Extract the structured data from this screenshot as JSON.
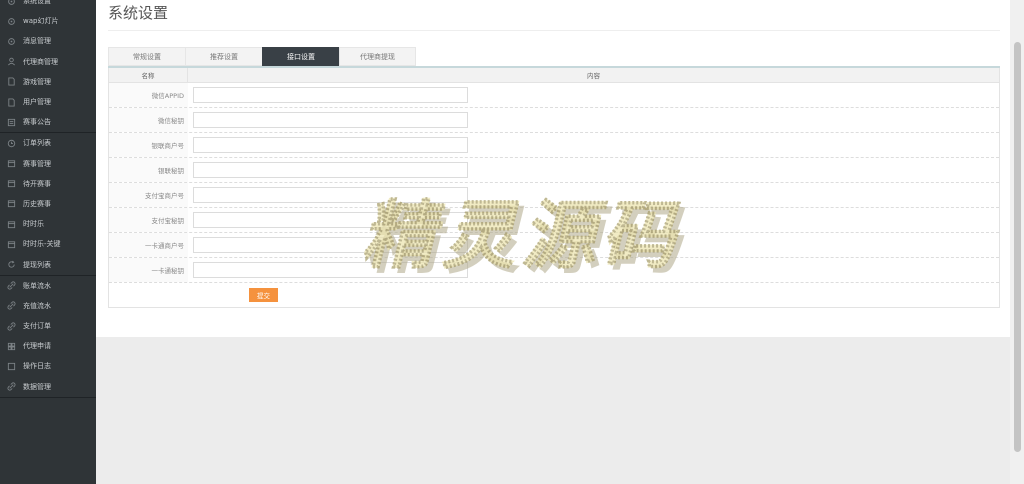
{
  "sidebar": {
    "groups": [
      {
        "items": [
          {
            "label": "系统设置",
            "icon": "gear-icon"
          },
          {
            "label": "wap幻灯片",
            "icon": "gear-icon"
          },
          {
            "label": "消息管理",
            "icon": "gear-icon"
          },
          {
            "label": "代理商管理",
            "icon": "user-icon"
          },
          {
            "label": "游戏管理",
            "icon": "doc-icon"
          },
          {
            "label": "用户管理",
            "icon": "doc-icon"
          },
          {
            "label": "赛事公告",
            "icon": "list-icon"
          }
        ]
      },
      {
        "items": [
          {
            "label": "订单列表",
            "icon": "clock-icon"
          },
          {
            "label": "赛事管理",
            "icon": "calendar-icon"
          },
          {
            "label": "待开赛事",
            "icon": "calendar-icon"
          },
          {
            "label": "历史赛事",
            "icon": "calendar-icon"
          },
          {
            "label": "时时乐",
            "icon": "calendar-icon"
          },
          {
            "label": "时时乐-关键",
            "icon": "calendar-icon"
          },
          {
            "label": "提现列表",
            "icon": "refresh-icon"
          }
        ]
      },
      {
        "items": [
          {
            "label": "账单流水",
            "icon": "link-icon"
          },
          {
            "label": "充值流水",
            "icon": "link-icon"
          },
          {
            "label": "支付订单",
            "icon": "link-icon"
          },
          {
            "label": "代理申请",
            "icon": "grid-icon"
          },
          {
            "label": "操作日志",
            "icon": "square-icon"
          },
          {
            "label": "数据管理",
            "icon": "link-icon"
          }
        ]
      }
    ]
  },
  "page": {
    "title": "系统设置"
  },
  "tabs": [
    {
      "label": "常规设置",
      "active": false
    },
    {
      "label": "推荐设置",
      "active": false
    },
    {
      "label": "接口设置",
      "active": true
    },
    {
      "label": "代理商提现",
      "active": false
    }
  ],
  "table": {
    "headers": {
      "name": "名称",
      "content": "内容"
    },
    "rows": [
      {
        "label": "微信APPID",
        "value": ""
      },
      {
        "label": "微信秘钥",
        "value": ""
      },
      {
        "label": "银联商户号",
        "value": ""
      },
      {
        "label": "银联秘钥",
        "value": ""
      },
      {
        "label": "支付宝商户号",
        "value": ""
      },
      {
        "label": "支付宝秘钥",
        "value": ""
      },
      {
        "label": "一卡通商户号",
        "value": ""
      },
      {
        "label": "一卡通秘钥",
        "value": ""
      }
    ],
    "submit_label": "提交"
  },
  "watermark": {
    "text": "精灵源码"
  },
  "colors": {
    "sidebar_bg": "#2f3437",
    "active_tab": "#394046",
    "submit": "#f5923e"
  }
}
